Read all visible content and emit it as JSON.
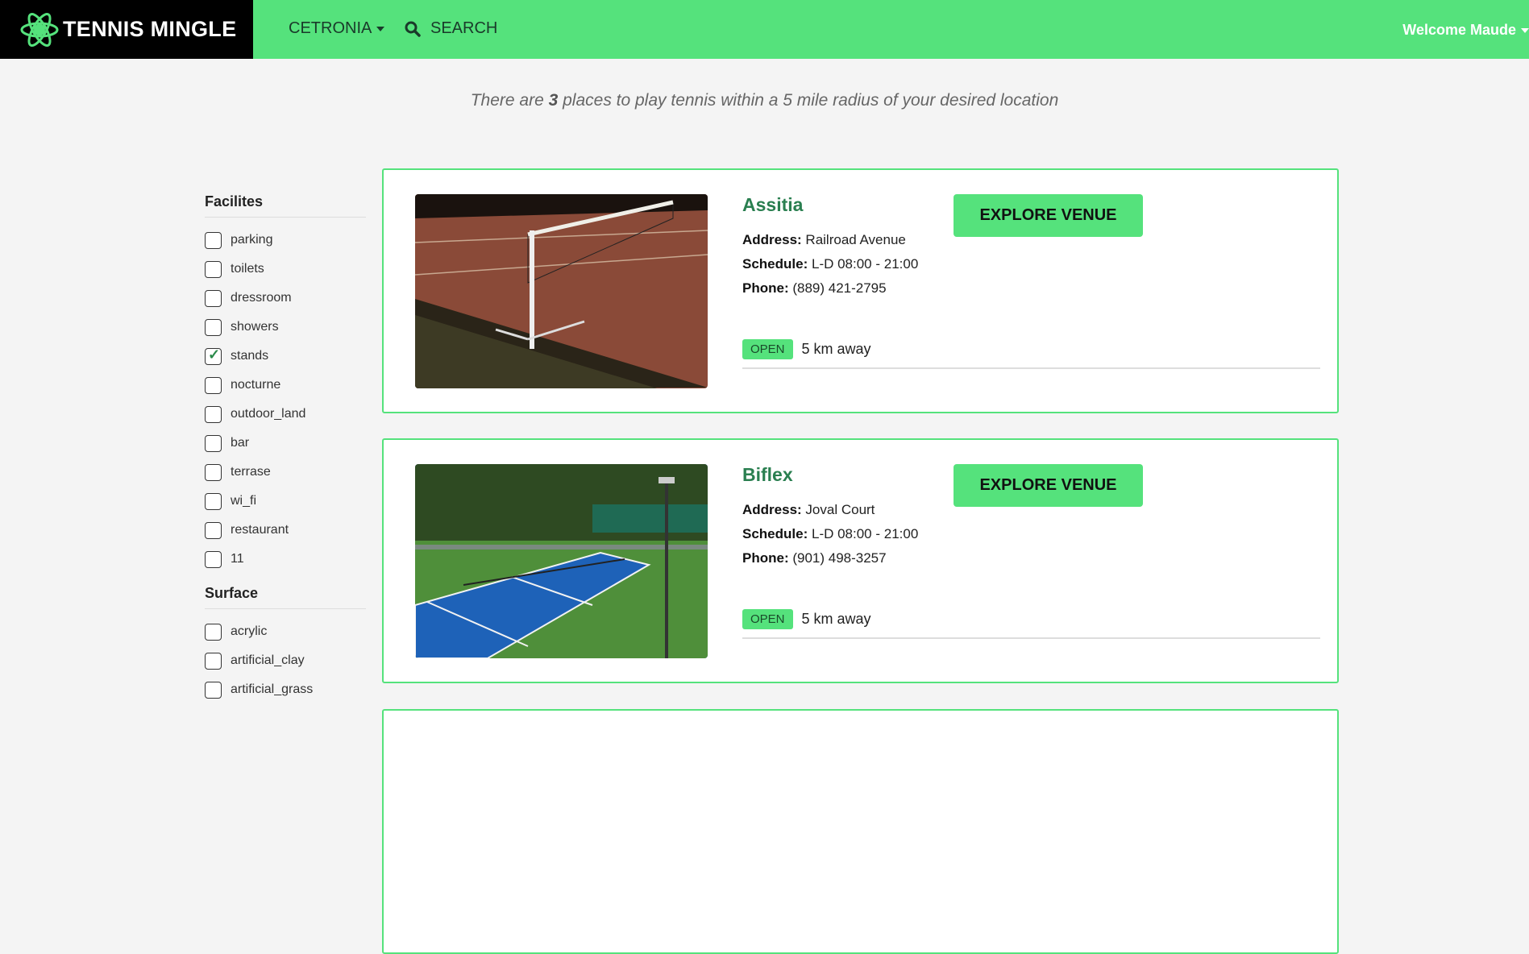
{
  "navbar": {
    "brand": "TENNIS MINGLE",
    "city": "CETRONIA",
    "search_label": "SEARCH",
    "user_label": "Welcome Maude"
  },
  "summary": {
    "prefix": "There are ",
    "count": "3",
    "suffix": " places to play tennis within a 5 mile radius of your desired location"
  },
  "filters": {
    "facilities": {
      "title": "Facilites",
      "items": [
        {
          "label": "parking",
          "checked": false
        },
        {
          "label": "toilets",
          "checked": false
        },
        {
          "label": "dressroom",
          "checked": false
        },
        {
          "label": "showers",
          "checked": false
        },
        {
          "label": "stands",
          "checked": true
        },
        {
          "label": "nocturne",
          "checked": false
        },
        {
          "label": "outdoor_land",
          "checked": false
        },
        {
          "label": "bar",
          "checked": false
        },
        {
          "label": "terrase",
          "checked": false
        },
        {
          "label": "wi_fi",
          "checked": false
        },
        {
          "label": "restaurant",
          "checked": false
        },
        {
          "label": "11",
          "checked": false
        }
      ]
    },
    "surface": {
      "title": "Surface",
      "items": [
        {
          "label": "acrylic",
          "checked": false
        },
        {
          "label": "artificial_clay",
          "checked": false
        },
        {
          "label": "artificial_grass",
          "checked": false
        }
      ]
    }
  },
  "venues": [
    {
      "name": "Assitia",
      "address_label": "Address:",
      "address": "Railroad Avenue",
      "schedule_label": "Schedule:",
      "schedule": "L-D 08:00 - 21:00",
      "phone_label": "Phone:",
      "phone": "(889) 421-2795",
      "button": "EXPLORE VENUE",
      "status": "OPEN",
      "distance": "5 km away"
    },
    {
      "name": "Biflex",
      "address_label": "Address:",
      "address": "Joval Court",
      "schedule_label": "Schedule:",
      "schedule": "L-D 08:00 - 21:00",
      "phone_label": "Phone:",
      "phone": "(901) 498-3257",
      "button": "EXPLORE VENUE",
      "status": "OPEN",
      "distance": "5 km away"
    }
  ],
  "colors": {
    "accent": "#55e27c",
    "brand_bg": "#000000",
    "venue_name": "#2a7f50"
  }
}
